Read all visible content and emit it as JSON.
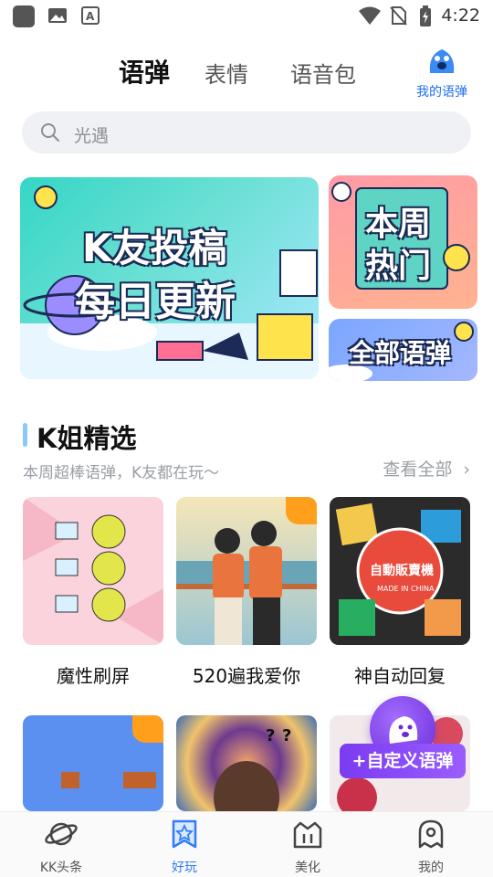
{
  "status_bar": {
    "time": "4:22",
    "icons": [
      "app-icon",
      "gallery-icon",
      "font-icon",
      "wifi-icon",
      "no-sim-icon",
      "battery-charging-icon"
    ]
  },
  "header": {
    "tabs": [
      {
        "label": "语弹",
        "active": true
      },
      {
        "label": "表情",
        "active": false
      },
      {
        "label": "语音包",
        "active": false
      }
    ],
    "my_danmaku_label": "我的语弹",
    "accent_color": "#1f6ff0"
  },
  "search": {
    "placeholder": "光遇",
    "icon": "search-icon"
  },
  "banners": {
    "main": {
      "line1": "K友投稿",
      "line2": "每日更新"
    },
    "hot": {
      "line1": "本周",
      "line2": "热门"
    },
    "all": {
      "label": "全部语弹"
    }
  },
  "section": {
    "title": "K姐精选",
    "subtitle": "本周超棒语弹，K友都在玩～",
    "more_label": "查看全部"
  },
  "cards": [
    {
      "label": "魔性刷屏"
    },
    {
      "label": "520遍我爱你"
    },
    {
      "label": "神自动回复",
      "sticker_text": "自動販賣機",
      "sticker_sub": "MADE IN CHINA"
    },
    {
      "label": ""
    },
    {
      "label": ""
    },
    {
      "label": ""
    }
  ],
  "fab": {
    "label": "+自定义语弹"
  },
  "bottom_nav": [
    {
      "label": "KK头条",
      "icon": "planet-icon",
      "active": false
    },
    {
      "label": "好玩",
      "icon": "star-bookmark-icon",
      "active": true
    },
    {
      "label": "美化",
      "icon": "crown-house-icon",
      "active": false
    },
    {
      "label": "我的",
      "icon": "ghost-icon",
      "active": false
    }
  ]
}
